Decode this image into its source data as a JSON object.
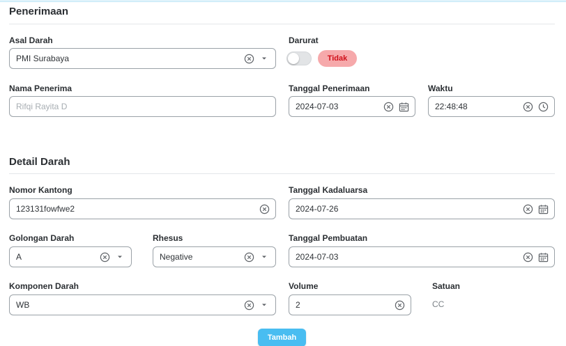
{
  "sections": {
    "penerimaan_title": "Penerimaan",
    "detail_title": "Detail Darah"
  },
  "penerimaan": {
    "asal_darah": {
      "label": "Asal Darah",
      "value": "PMI Surabaya"
    },
    "darurat": {
      "label": "Darurat",
      "checked": false,
      "badge": "Tidak"
    },
    "nama_penerima": {
      "label": "Nama Penerima",
      "placeholder": "Rifqi Rayita D"
    },
    "tanggal_penerimaan": {
      "label": "Tanggal Penerimaan",
      "value": "2024-07-03"
    },
    "waktu": {
      "label": "Waktu",
      "value": "22:48:48"
    }
  },
  "detail": {
    "nomor_kantong": {
      "label": "Nomor Kantong",
      "value": "123131fowfwe2"
    },
    "tanggal_kadaluarsa": {
      "label": "Tanggal Kadaluarsa",
      "value": "2024-07-26"
    },
    "golongan_darah": {
      "label": "Golongan Darah",
      "value": "A"
    },
    "rhesus": {
      "label": "Rhesus",
      "value": "Negative"
    },
    "tanggal_pembuatan": {
      "label": "Tanggal Pembuatan",
      "value": "2024-07-03"
    },
    "komponen_darah": {
      "label": "Komponen Darah",
      "value": "WB"
    },
    "volume": {
      "label": "Volume",
      "value": "2"
    },
    "satuan": {
      "label": "Satuan",
      "value": "CC"
    }
  },
  "actions": {
    "submit_label": "Tambah"
  },
  "colors": {
    "accent": "#49bdf1",
    "badge_bg": "#f6a9ab",
    "badge_text": "#d0101a"
  }
}
